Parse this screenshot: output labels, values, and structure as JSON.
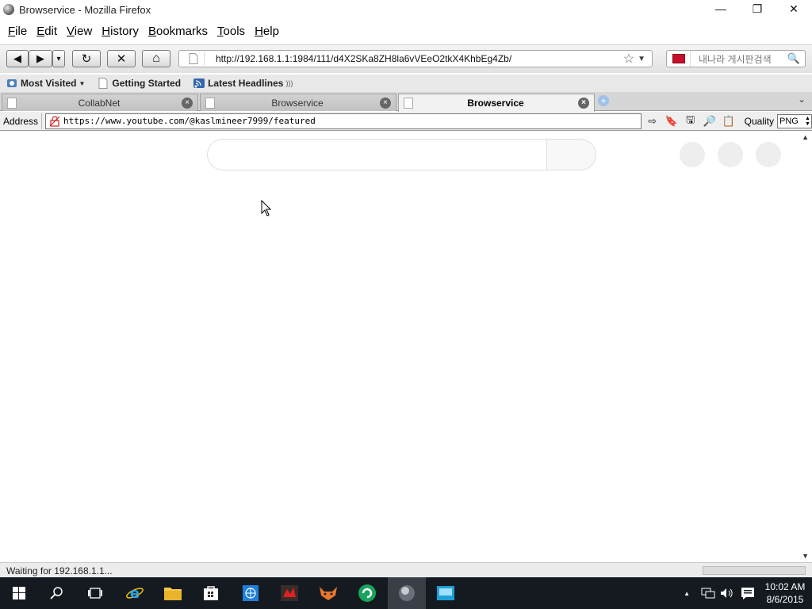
{
  "window": {
    "title": "Browservice - Mozilla Firefox",
    "controls": [
      "—",
      "❐",
      "✕"
    ]
  },
  "menu": [
    "File",
    "Edit",
    "View",
    "History",
    "Bookmarks",
    "Tools",
    "Help"
  ],
  "menu_hotkeys": [
    "F",
    "E",
    "V",
    "H",
    "B",
    "T",
    "H"
  ],
  "nav": {
    "back": "◀",
    "forward": "▶",
    "history_drop": "▾",
    "reload": "↻",
    "stop": "✕",
    "home": "⌂",
    "url": "http://192.168.1.1:1984/111/d4X2SKa8ZH8la6vVEeO2tkX4KhbEg4Zb/",
    "star": "☆",
    "url_dropdown": "▼",
    "search_placeholder": "내나라 게시판검색",
    "search_icon": "🔍"
  },
  "bookmarks": [
    {
      "label": "Most Visited",
      "has_dropdown": true,
      "icon": "most-visited-icon"
    },
    {
      "label": "Getting Started",
      "icon": "page-icon"
    },
    {
      "label": "Latest Headlines",
      "icon": "rss-icon"
    }
  ],
  "tabs": [
    {
      "label": "CollabNet",
      "active": false
    },
    {
      "label": "Browservice",
      "active": false
    },
    {
      "label": "Browservice",
      "active": true
    }
  ],
  "tab_close": "×",
  "tab_new": "+",
  "tabs_list": "⌄",
  "addrbar": {
    "label": "Address",
    "url": "https://www.youtube.com/@kaslmineer7999/featured",
    "quality_label": "Quality",
    "quality_value": "PNG",
    "tools": [
      "⇨",
      "🔖",
      "🖫",
      "🔎",
      "📋"
    ]
  },
  "scroll": {
    "up": "▲",
    "down": "▼"
  },
  "status": {
    "text": "Waiting for 192.168.1.1..."
  },
  "taskbar": {
    "time": "10:02 AM",
    "date": "8/6/2015",
    "tray_up": "▲"
  },
  "colors": {
    "taskbar_bg": "#151a21",
    "tab_active_bg": "#f2f2f2",
    "yt_placeholder": "#eeeeee"
  }
}
